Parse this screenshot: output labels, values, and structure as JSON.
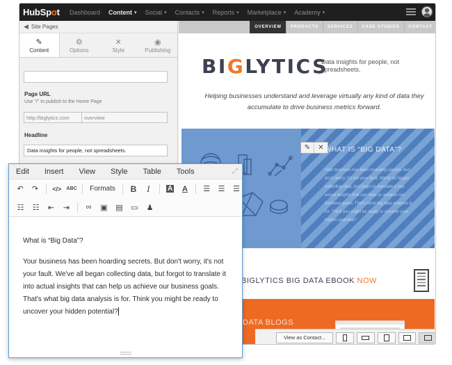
{
  "nav": {
    "logo_pre": "HubSp",
    "logo_o": "o",
    "logo_post": "t",
    "items": [
      "Dashboard",
      "Content",
      "Social",
      "Contacts",
      "Reports",
      "Marketplace",
      "Academy"
    ]
  },
  "left": {
    "back_label": "Site Pages",
    "tabs": [
      "Content",
      "Options",
      "Style",
      "Publishing"
    ],
    "page_url_label": "Page URL",
    "page_url_hint": "Use \"/\" to publish to the Home Page",
    "url_prefix": "http://biglytics.com",
    "url_slug": "overview",
    "headline_label": "Headline",
    "headline_value": "Data insights for people, not spreadsheets."
  },
  "preview": {
    "nav": [
      "OVERVIEW",
      "PRODUCTS",
      "SERVICES",
      "CASE STUDIES",
      "CONTACT"
    ],
    "brand_a": "BI",
    "brand_g": "G",
    "brand_b": "LYTICS",
    "tagline": "Data insights for people, not spreadsheets.",
    "intro": "Helping businesses understand and leverage virtually any kind of data they accumulate to drive business metrics forward.",
    "banner_title": "WHAT IS “BIG DATA”?",
    "banner_body": "Your business has been hoarding secrets. But don't worry, it's not your fault. We've all began collecting data, but forgot to translate it into actual insights that can help us achieve our business goals. That's what big data analysis is for. Think you might be ready to uncover your hidden potential?",
    "ebook_text": "BIGLYTICS BIG DATA EBOOK",
    "ebook_now": "NOW",
    "blogs_text": "DATA BLOGS",
    "view_as_contact": "View as Contact...",
    "colors": {
      "orange": "#f47622",
      "blue": "#6f9ad0",
      "dark": "#3d4150"
    }
  },
  "editor": {
    "menu": [
      "Edit",
      "Insert",
      "View",
      "Style",
      "Table",
      "Tools"
    ],
    "formats_label": "Formats",
    "heading": "What is “Big Data”?",
    "body": "Your business has been hoarding secrets. But don't worry, it's not your fault. We've all began collecting data, but forgot to translate it into actual insights that can help us achieve our business goals. That's what big data analysis is for. Think you might be ready to uncover your hidden potential?"
  }
}
